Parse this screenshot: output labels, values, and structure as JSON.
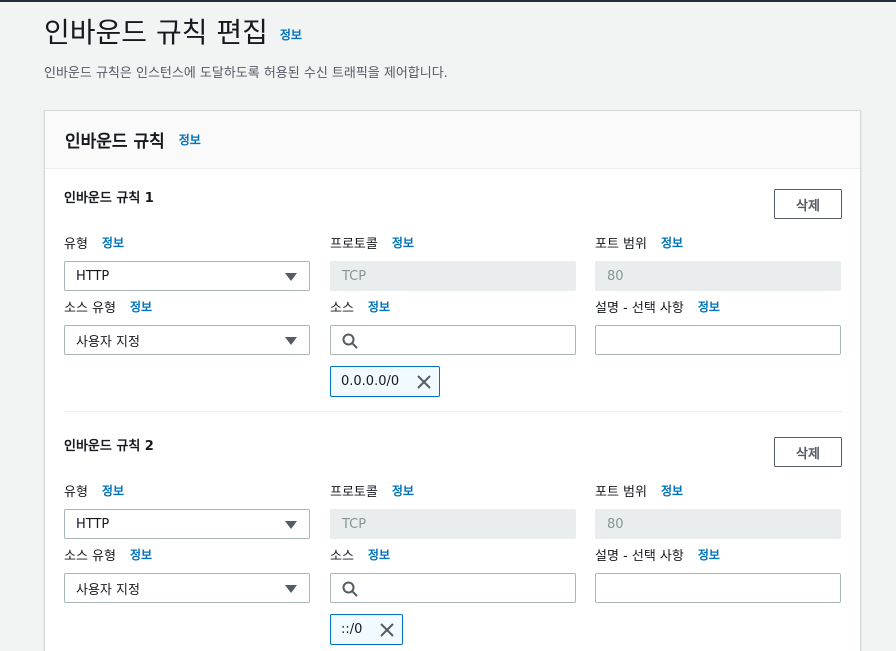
{
  "page": {
    "title": "인바운드 규칙 편집",
    "info": "정보",
    "description": "인바운드 규칙은 인스턴스에 도달하도록 허용된 수신 트래픽을 제어합니다."
  },
  "panel": {
    "title": "인바운드 규칙",
    "info": "정보"
  },
  "labels": {
    "info": "정보",
    "type": "유형",
    "protocol": "프로토콜",
    "port_range": "포트 범위",
    "source_type": "소스 유형",
    "source": "소스",
    "description": "설명 - 선택 사항",
    "delete": "삭제"
  },
  "rules": [
    {
      "title": "인바운드 규칙 1",
      "type": "HTTP",
      "protocol": "TCP",
      "port_range": "80",
      "source_type": "사용자 지정",
      "source_search": "",
      "source_token": "0.0.0.0/0",
      "description": ""
    },
    {
      "title": "인바운드 규칙 2",
      "type": "HTTP",
      "protocol": "TCP",
      "port_range": "80",
      "source_type": "사용자 지정",
      "source_search": "",
      "source_token": "::/0",
      "description": ""
    }
  ],
  "colors": {
    "link": "#0073bb",
    "token_bg": "#f1faff",
    "disabled_bg": "#eaeded"
  },
  "icons": {
    "caret": "caret-down-icon",
    "search": "search-icon",
    "remove": "close-icon"
  }
}
